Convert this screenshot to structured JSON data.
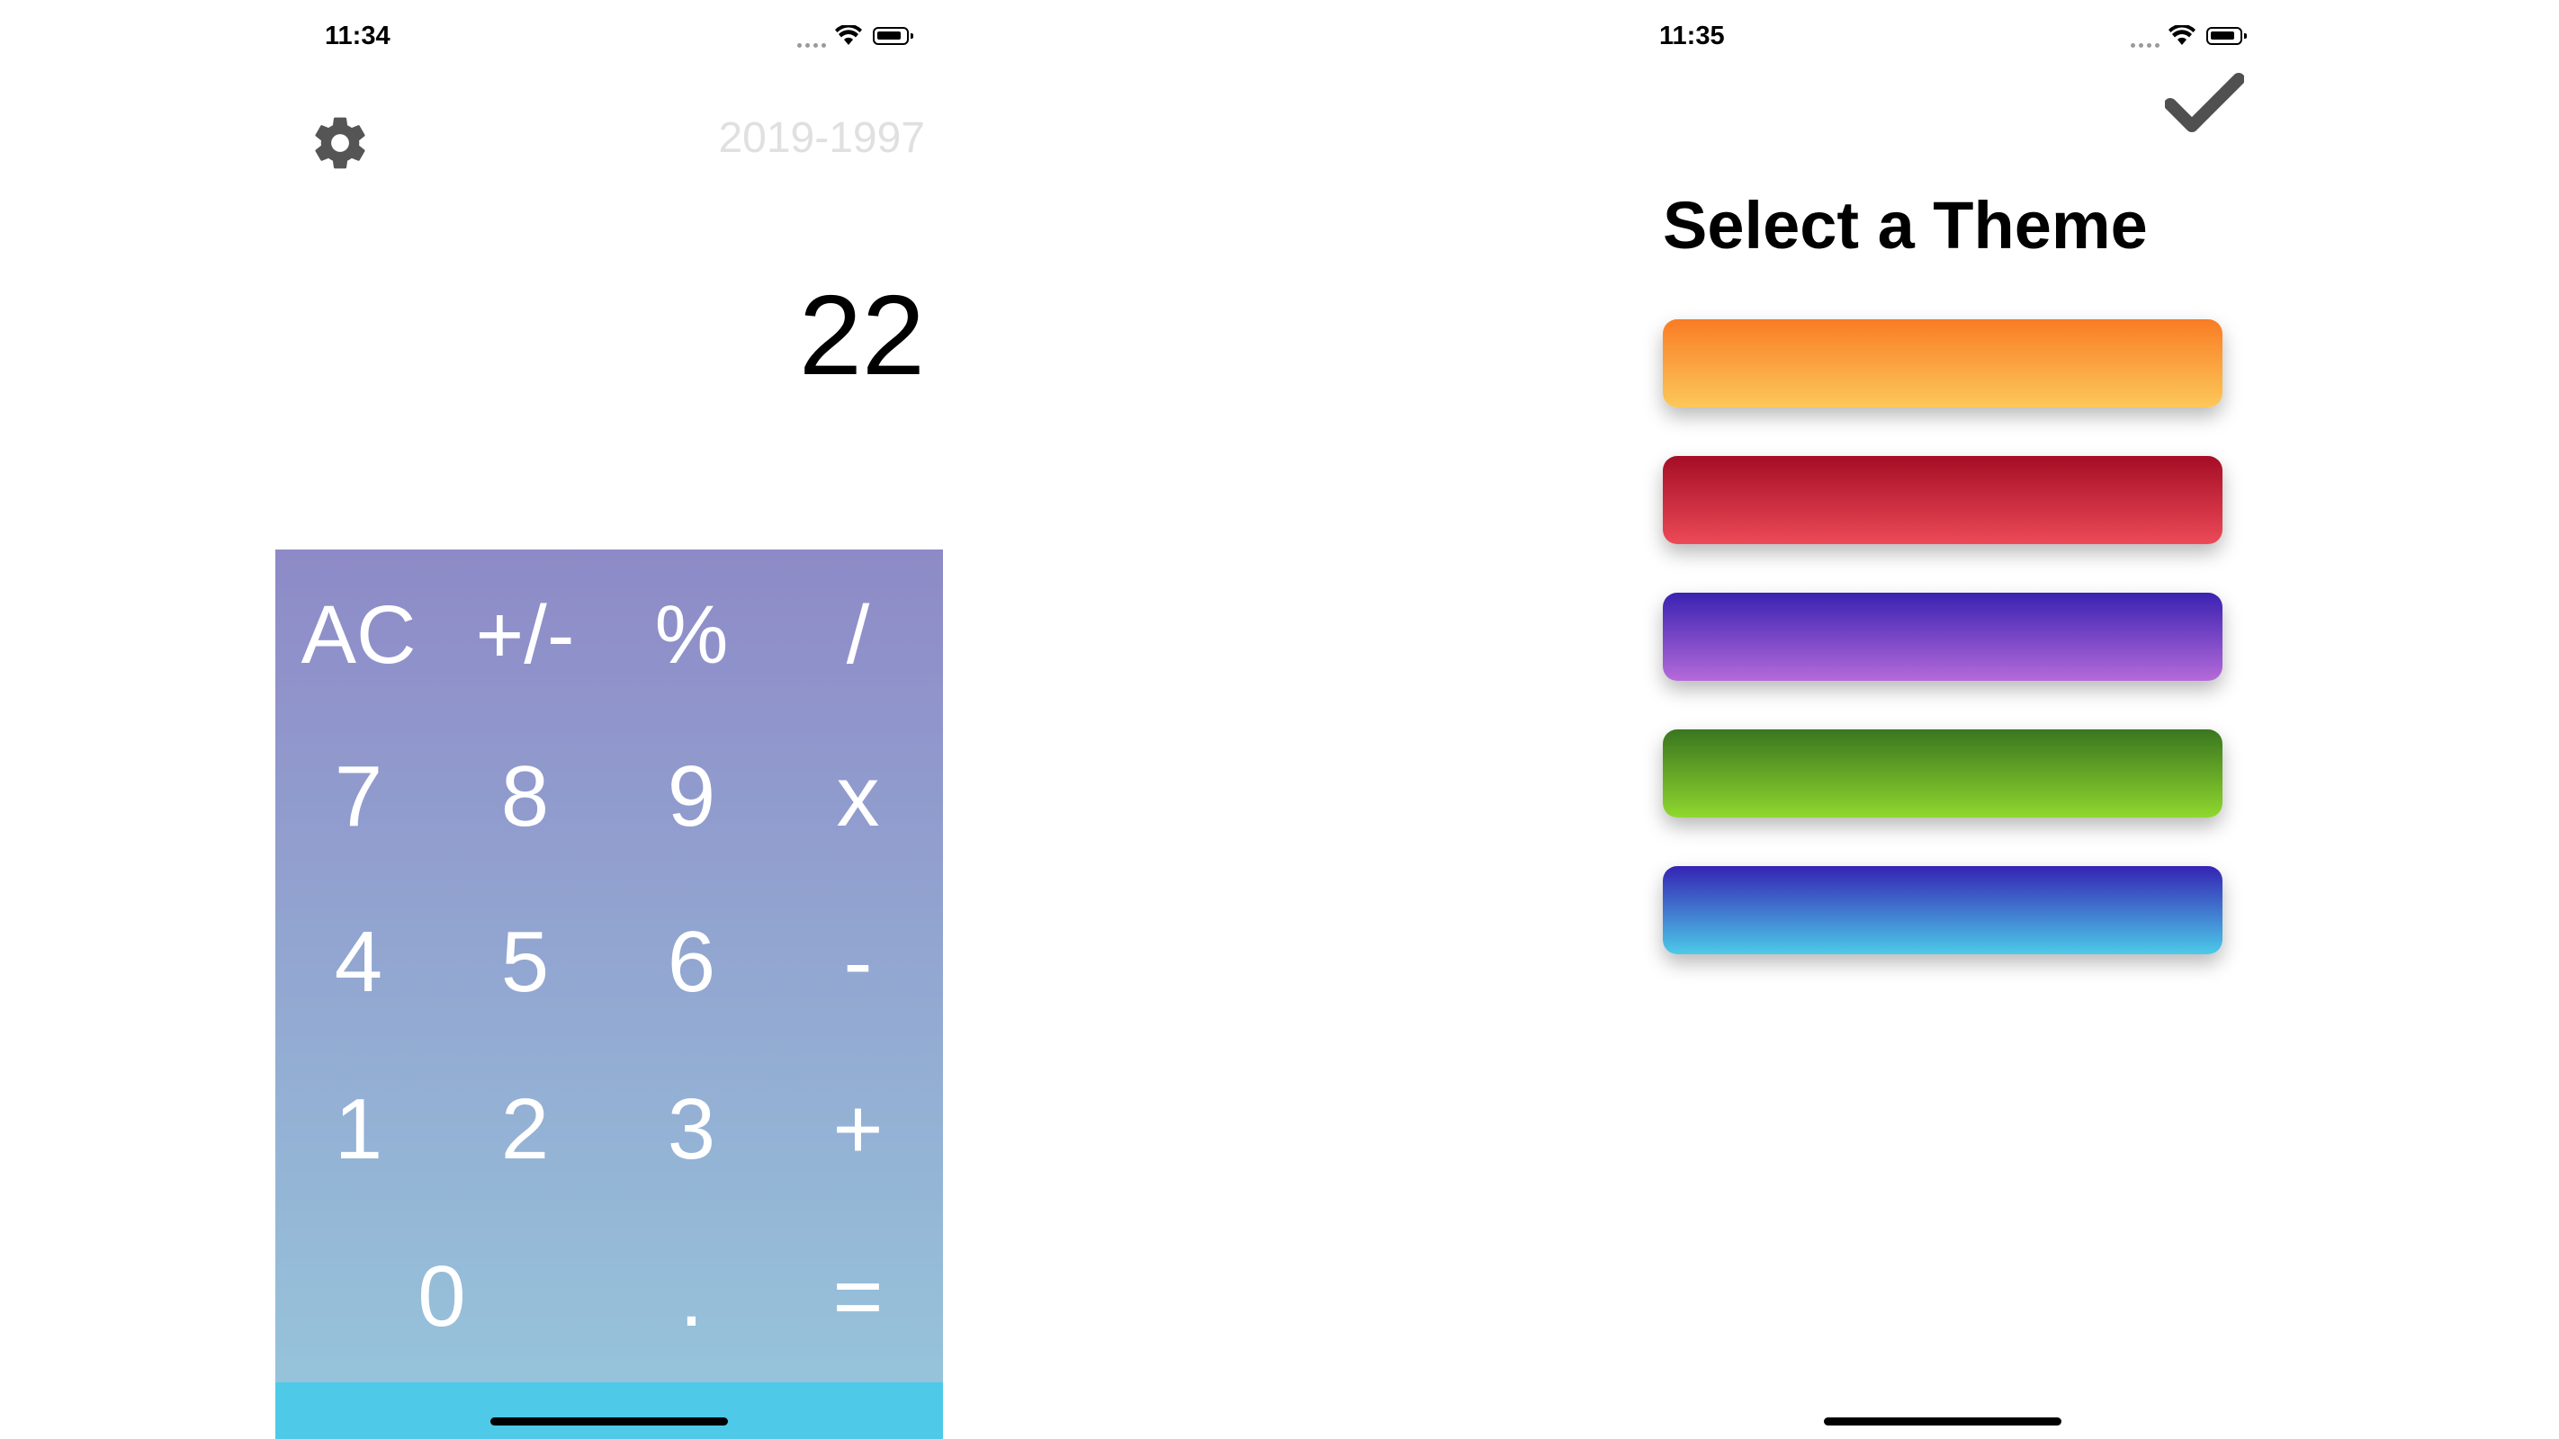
{
  "left_screen": {
    "status_bar": {
      "time": "11:34"
    },
    "header": {
      "settings_icon": "gear-icon",
      "expression": "2019-1997"
    },
    "display_value": "22",
    "keypad": {
      "rows": [
        [
          "AC",
          "+/-",
          "%",
          "/"
        ],
        [
          "7",
          "8",
          "9",
          "x"
        ],
        [
          "4",
          "5",
          "6",
          "-"
        ],
        [
          "1",
          "2",
          "3",
          "+"
        ],
        [
          "0",
          ".",
          "="
        ]
      ],
      "gradient_top": "#8e8ac7",
      "gradient_bottom": "#97c7dc",
      "bottom_strip": "#4ec9e8"
    }
  },
  "right_screen": {
    "status_bar": {
      "time": "11:35"
    },
    "confirm_icon": "checkmark-icon",
    "title": "Select a Theme",
    "themes": [
      {
        "name": "orange",
        "top": "#f97c24",
        "bottom": "#fcc85a"
      },
      {
        "name": "red",
        "top": "#a50d25",
        "bottom": "#ec4a57"
      },
      {
        "name": "purple",
        "top": "#3a22b1",
        "bottom": "#b56ad9"
      },
      {
        "name": "green",
        "top": "#3a7520",
        "bottom": "#8fd82e"
      },
      {
        "name": "blue",
        "top": "#3523b4",
        "bottom": "#4ccae9"
      }
    ]
  }
}
